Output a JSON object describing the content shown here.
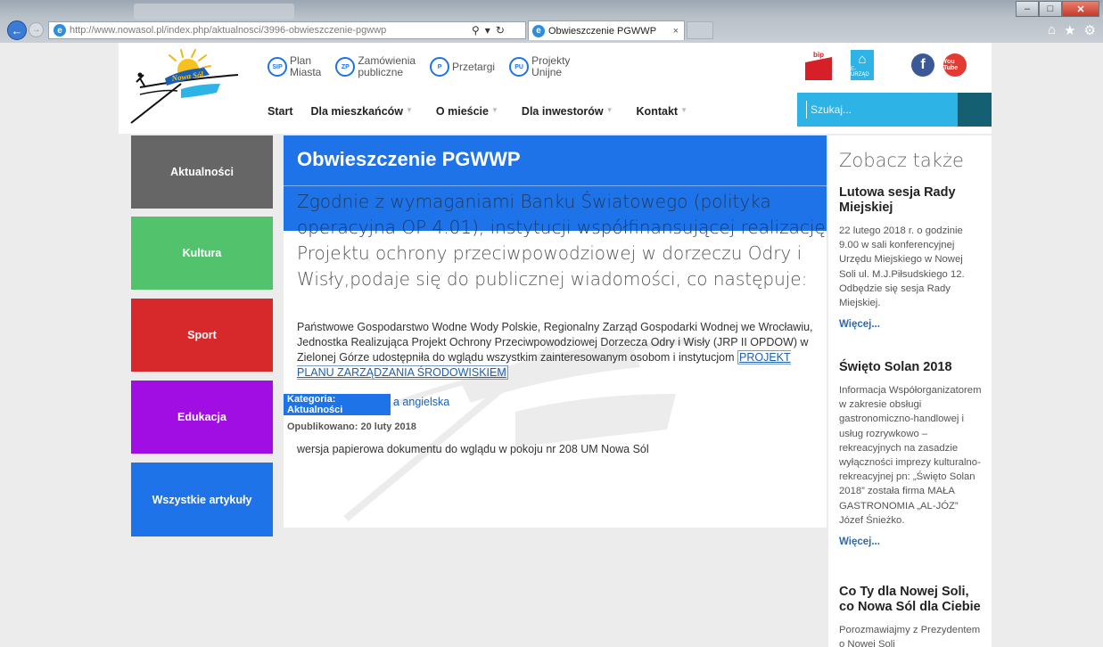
{
  "browser": {
    "url": "http://www.nowasol.pl/index.php/aktualnosci/3996-obwieszczenie-pgwwp",
    "tab_title": "Obwieszczenie PGWWP",
    "tab_close": "×",
    "back_glyph": "←",
    "forward_glyph": "→"
  },
  "header": {
    "logo_text": "Nowa Sól",
    "top_links": [
      {
        "badge": "SIP",
        "label_1": "Plan",
        "label_2": "Miasta"
      },
      {
        "badge": "ZP",
        "label_1": "Zamówienia",
        "label_2": "publiczne"
      },
      {
        "badge": "P",
        "label_1": "Przetargi",
        "label_2": ""
      },
      {
        "badge": "PU",
        "label_1": "Projekty",
        "label_2": "Unijne"
      }
    ],
    "bip": "bip",
    "eurzad": "E-URZĄD",
    "facebook": "f",
    "youtube": "You Tube"
  },
  "nav": {
    "items": [
      "Start",
      "Dla mieszkańców",
      "O mieście",
      "Dla inwestorów",
      "Kontakt"
    ]
  },
  "search": {
    "placeholder": "Szukaj..."
  },
  "categories": [
    "Aktualności",
    "Kultura",
    "Sport",
    "Edukacja",
    "Wszystkie artykuły"
  ],
  "category_colors": [
    "#666666",
    "#53c26c",
    "#d7292c",
    "#a10ee3",
    "#1e73e8"
  ],
  "article": {
    "title": "Obwieszczenie PGWWP",
    "lead_lines": [
      "Zgodnie z wymaganiami Banku Światowego (polityka",
      "operacyjna OP 4.01), instytucji współfinansującej realizację",
      "Projektu ochrony przeciwpowodziowej w dorzeczu Odry i",
      "Wisły,podaje się do publicznej wiadomości, co następuje:"
    ],
    "body": "Państwowe Gospodarstwo Wodne Wody Polskie, Regionalny Zarząd Gospodarki Wodnej we Wrocławiu, Jednostka Realizująca Projekt Ochrony Przeciwpowodziowej Dorzecza Odry i Wisły (JRP II OPDOW) w Zielonej Górze udostępniła do wglądu wszystkim zainteresowanym osobom i instytucjom",
    "body_link": "PROJEKT PLANU ZARZĄDZANIA ŚRODOWISKIEM",
    "category_badge": "Kategoria: Aktualności",
    "lang_link": "a angielska",
    "published": "Opublikowano: 20 luty 2018",
    "paper_version": "wersja papierowa dokumentu do wglądu w pokoju nr 208 UM Nowa Sól"
  },
  "aside": {
    "heading": "Zobacz także",
    "items": [
      {
        "title": "Lutowa sesja Rady Miejskiej",
        "text": "22 lutego 2018 r. o godzinie 9.00 w sali konferencyjnej Urzędu Miejskiego w Nowej Soli ul. M.J.Piłsudskiego 12. Odbędzie się sesja Rady Miejskiej.",
        "more": "Więcej..."
      },
      {
        "title": "Święto Solan 2018",
        "text": "Informacja Współorganizatorem w zakresie obsługi gastronomiczno-handlowej i usług rozrywkowo – rekreacyjnych na zasadzie wyłączności imprezy kulturalno-rekreacyjnej pn: „Święto Solan 2018” została firma MAŁA GASTRONOMIA „AL-JÓZ” Józef Śnieżko.",
        "more": "Więcej..."
      },
      {
        "title": "Co Ty dla Nowej Soli, co Nowa Sól dla Ciebie",
        "text": "Porozmawiajmy z Prezydentem o Nowej Soli",
        "more": ""
      }
    ]
  }
}
